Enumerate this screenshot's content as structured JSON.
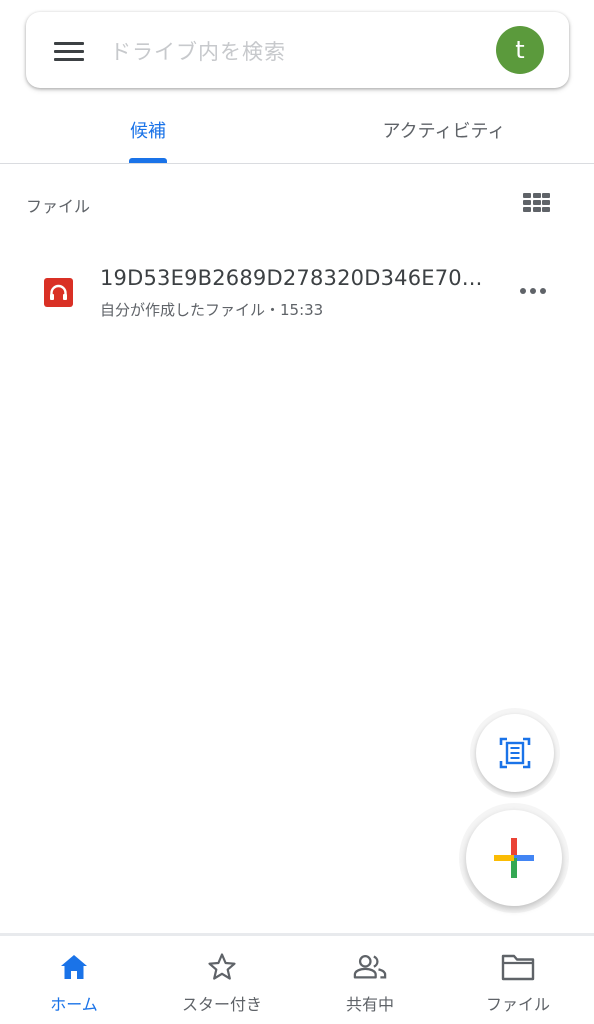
{
  "search": {
    "placeholder": "ドライブ内を検索",
    "avatar_initial": "t",
    "avatar_color": "#5b9a3c"
  },
  "tabs": [
    {
      "label": "候補",
      "active": true
    },
    {
      "label": "アクティビティ",
      "active": false
    }
  ],
  "section": {
    "label": "ファイル",
    "view_toggle_icon": "grid-view-icon"
  },
  "files": [
    {
      "name": "19D53E9B2689D278320D346E70...",
      "meta": "自分が作成したファイル・15:33",
      "icon": "audio-file-icon",
      "icon_color": "#d93025"
    }
  ],
  "fabs": {
    "scan_icon": "document-scan-icon",
    "new_icon": "plus-icon"
  },
  "bottom_nav": [
    {
      "label": "ホーム",
      "icon": "home-icon",
      "active": true
    },
    {
      "label": "スター付き",
      "icon": "star-icon",
      "active": false
    },
    {
      "label": "共有中",
      "icon": "people-icon",
      "active": false
    },
    {
      "label": "ファイル",
      "icon": "folder-icon",
      "active": false
    }
  ],
  "colors": {
    "accent": "#1a73e8",
    "text_secondary": "#5f6368"
  }
}
